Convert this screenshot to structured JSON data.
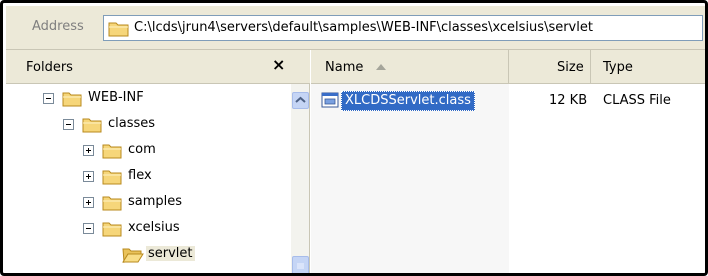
{
  "address_bar": {
    "label": "Address",
    "path": "C:\\lcds\\jrun4\\servers\\default\\samples\\WEB-INF\\classes\\xcelsius\\servlet"
  },
  "folders_pane": {
    "title": "Folders",
    "close_glyph": "×",
    "tree": [
      {
        "label": "WEB-INF",
        "expander": "minus",
        "icon": "folder-icon"
      },
      {
        "label": "classes",
        "expander": "minus",
        "icon": "folder-icon"
      },
      {
        "label": "com",
        "expander": "plus",
        "icon": "folder-icon"
      },
      {
        "label": "flex",
        "expander": "plus",
        "icon": "folder-icon"
      },
      {
        "label": "samples",
        "expander": "plus",
        "icon": "folder-icon"
      },
      {
        "label": "xcelsius",
        "expander": "minus",
        "icon": "folder-icon"
      },
      {
        "label": "servlet",
        "expander": "none",
        "icon": "open-folder-icon",
        "selected": true
      }
    ]
  },
  "file_list": {
    "columns": {
      "name": "Name",
      "size": "Size",
      "type": "Type"
    },
    "sort": {
      "column": "name",
      "direction": "ascending"
    },
    "rows": [
      {
        "name": "XLCDSServlet.class",
        "size": "12 KB",
        "type": "CLASS File",
        "selected": true,
        "icon": "class-file-icon"
      }
    ]
  },
  "colors": {
    "chrome": "#ece9d8",
    "selection": "#316ac5",
    "folder": "#f6d67a",
    "scrollbar": "#c5d5f5"
  }
}
